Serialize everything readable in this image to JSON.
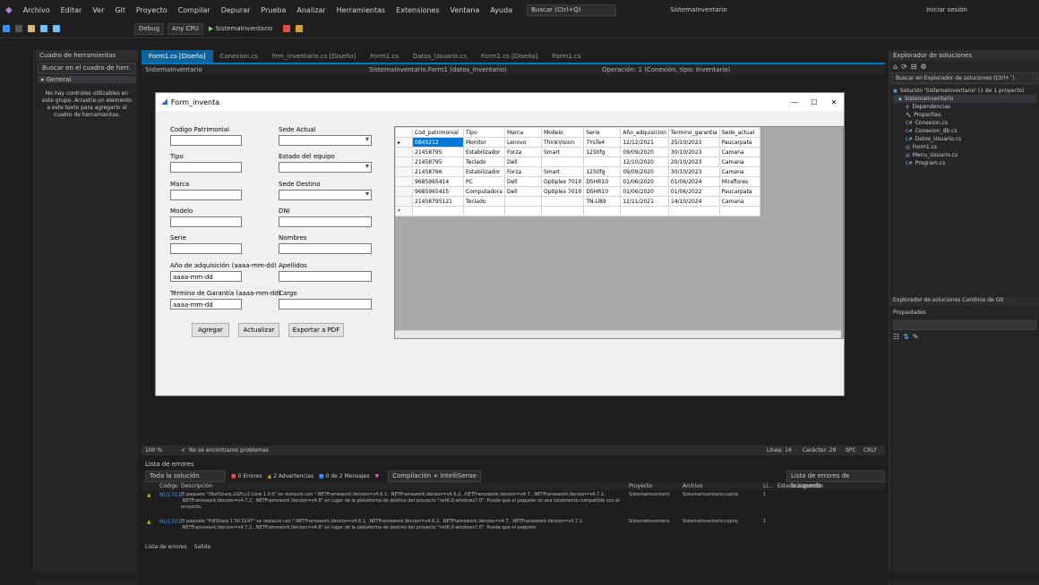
{
  "menu": [
    "Archivo",
    "Editar",
    "Ver",
    "Git",
    "Proyecto",
    "Compilar",
    "Depurar",
    "Prueba",
    "Analizar",
    "Herramientas",
    "Extensiones",
    "Ventana",
    "Ayuda"
  ],
  "search_box": "Buscar (Ctrl+Q)",
  "solution_name": "SistemaInventario",
  "account": "Iniciar sesión",
  "toolbar": {
    "config": "Debug",
    "platform": "Any CPU",
    "start": "SistemaInventario"
  },
  "toolbox": {
    "title": "Cuadro de herramientas",
    "search": "Buscar en el cuadro de herr.",
    "group": "▸ General",
    "message": "No hay controles utilizables en este grupo. Arrastre un elemento a este texto para agregarlo al cuadro de herramientas."
  },
  "tabs": [
    "Form1.cs [Diseño]",
    "Conexion.cs",
    "Frm_inventario.cs [Diseño]",
    "Form1.cs",
    "Datos_Usuario.cs",
    "Form1.cs [Diseño]",
    "Form1.cs"
  ],
  "navbar": {
    "left": "SistemaInventario",
    "mid": "SistemaInventario.Form1 (datos_inventario)",
    "right": "Operación: 1 (Conexión, tipo: Inventario)"
  },
  "form": {
    "title": "Form_inventa",
    "fields_left": [
      {
        "label": "Codigo Patrimonial",
        "value": ""
      },
      {
        "label": "Tipo",
        "value": ""
      },
      {
        "label": "Marca",
        "value": ""
      },
      {
        "label": "Modelo",
        "value": ""
      },
      {
        "label": "Serie",
        "value": ""
      },
      {
        "label": "Año de adquisición (aaaa-mm-dd)",
        "value": "aaaa-mm-dd"
      },
      {
        "label": "Término de Garantía (aaaa-mm-dd)",
        "value": "aaaa-mm-dd"
      }
    ],
    "fields_right": [
      {
        "label": "Sede Actual",
        "type": "combo"
      },
      {
        "label": "Estado del equipo",
        "type": "combo"
      },
      {
        "label": "Sede Destino",
        "type": "combo"
      },
      {
        "label": "DNI",
        "type": "text"
      },
      {
        "label": "Nombres",
        "type": "text"
      },
      {
        "label": "Apellidos",
        "type": "text"
      },
      {
        "label": "Cargo",
        "type": "text"
      }
    ],
    "buttons": {
      "add": "Agregar",
      "update": "Actualizar",
      "export": "Exportar a PDF"
    }
  },
  "grid": {
    "columns": [
      "Cod_patrimonial",
      "Tipo",
      "Marca",
      "Modelo",
      "Serie",
      "Año_adquisicion",
      "Termino_garantia",
      "Sede_actual"
    ],
    "rows": [
      [
        "0845212",
        "Monitor",
        "Lenovo",
        "ThinkVision",
        "7YsTe4",
        "12/12/2021",
        "25/10/2023",
        "Paucarpata"
      ],
      [
        "21458795",
        "Estabilizador",
        "Forza",
        "Smart",
        "1250fg",
        "09/09/2020",
        "30/10/2023",
        "Camana"
      ],
      [
        "21458795",
        "Teclado",
        "Dell",
        "",
        "",
        "12/10/2020",
        "20/10/2023",
        "Camana"
      ],
      [
        "21458796",
        "Estabilizador",
        "Forza",
        "Smart",
        "1250fg",
        "09/09/2020",
        "30/10/2023",
        "Camana"
      ],
      [
        "9685965414",
        "PC",
        "Dell",
        "Optiplex 7010",
        "D5HR10",
        "01/06/2020",
        "01/06/2024",
        "Miraflores"
      ],
      [
        "9685965415",
        "Computadora",
        "Dell",
        "Optiplex 7010",
        "D5HR10",
        "01/06/2020",
        "01/06/2022",
        "Paucarpata"
      ],
      [
        "21458795121",
        "Teclado",
        "",
        "",
        "TN-U89",
        "12/11/2021",
        "14/10/2024",
        "Camana"
      ]
    ]
  },
  "status_strip": {
    "zoom": "100 %",
    "issues": "No se encontraron problemas",
    "pos": "Línea: 14",
    "col": "Carácter: 29",
    "ins": "SPC",
    "crlf": "CRLF"
  },
  "error_list": {
    "title": "Lista de errores",
    "scope": "Toda la solución",
    "errors": "0 Errores",
    "warnings": "2 Advertencias",
    "messages": "0 de 2 Mensajes",
    "build": "Compilación + IntelliSense",
    "search": "Lista de errores de búsqueda",
    "cols": [
      "Código",
      "Descripción",
      "Proyecto",
      "Archivo",
      "Lí...",
      "Estado supresión"
    ],
    "items": [
      {
        "code": "NU1701",
        "desc": "El paquete \"iTextSharp.LGPLv2.Core 1.0.0\" se restauró con \".NETFramework,Version=v4.6.1, .NETFramework,Version=v4.6.2, .NETFramework,Version=v4.7, .NETFramework,Version=v4.7.1, .NETFramework,Version=v4.7.2, .NETFramework,Version=v4.8\" en lugar de la plataforma de destino del proyecto \"net6.0-windows7.0\". Puede que el paquete no sea totalmente compatible con el proyecto.",
        "project": "SistemaInventario",
        "file": "SistemaInventario.csproj",
        "line": "1"
      },
      {
        "code": "NU1701",
        "desc": "El paquete \"PdfSharp 1.50.5147\" se restauró con \".NETFramework,Version=v4.6.1, .NETFramework,Version=v4.6.2, .NETFramework,Version=v4.7, .NETFramework,Version=v4.7.1, .NETFramework,Version=v4.7.2, .NETFramework,Version=v4.8\" en lugar de la plataforma de destino del proyecto \"net6.0-windows7.0\". Puede que el paquete",
        "project": "SistemaInventario",
        "file": "SistemaInventario.csproj",
        "line": "1"
      }
    ],
    "bottom_tabs": [
      "Lista de errores",
      "Salida"
    ]
  },
  "solution_explorer": {
    "title": "Explorador de soluciones",
    "search": "Buscar en Explorador de soluciones (Ctrl+´)",
    "items": [
      "Solución 'SistemaInventario' (1 de 1 proyecto)",
      "SistemaInventario",
      "Dependencias",
      "Properties",
      "Conexion.cs",
      "Conexion_db.cs",
      "Datos_Usuario.cs",
      "Form1.cs",
      "Menu_Usuario.cs",
      "Program.cs"
    ]
  },
  "properties": {
    "title": "Explorador de soluciones  Cambios de Git",
    "sub": "Propiedades"
  }
}
